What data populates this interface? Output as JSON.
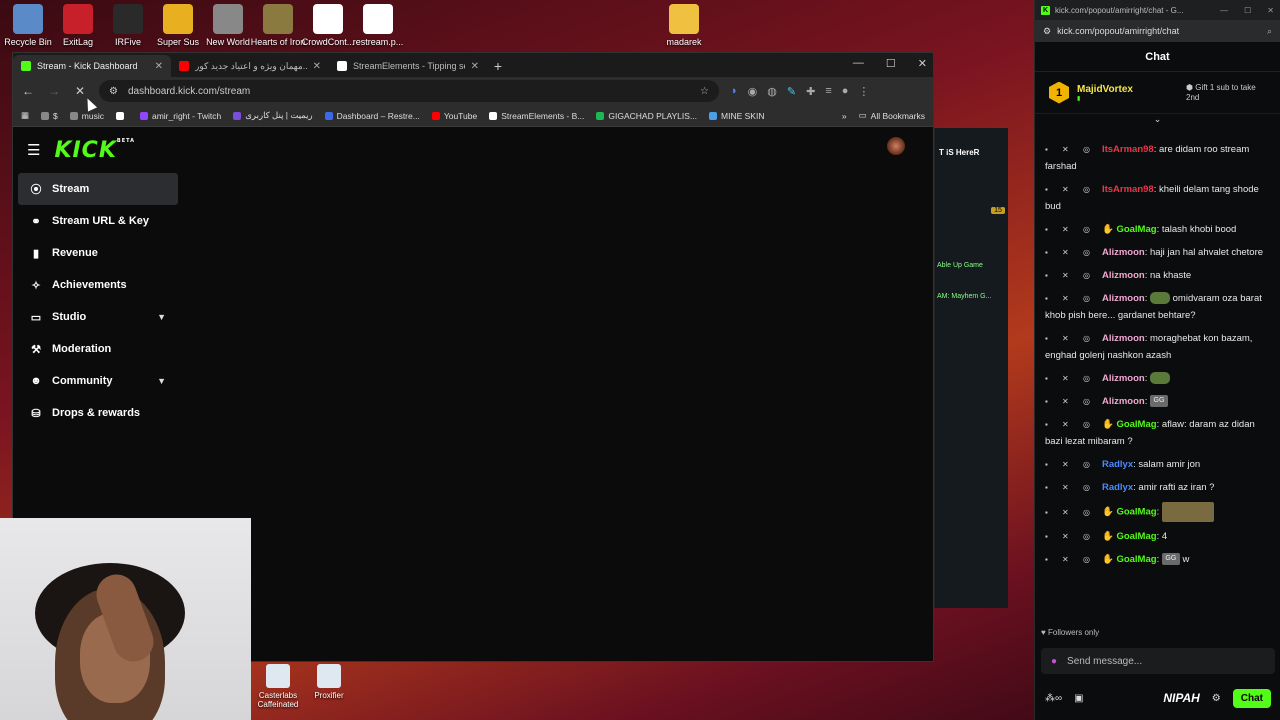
{
  "desktop": {
    "icons": [
      {
        "label": "Recycle Bin",
        "icon": "recycle-bin-icon",
        "color": "#5a8ac8"
      },
      {
        "label": "ExitLag",
        "icon": "exitlag-icon",
        "color": "#c8202a"
      },
      {
        "label": "IRFive",
        "icon": "irfive-icon",
        "color": "#2a2a2a"
      },
      {
        "label": "Super Sus",
        "icon": "supersus-icon",
        "color": "#e8b020"
      },
      {
        "label": "New World",
        "icon": "newworld-icon",
        "color": "#888888"
      },
      {
        "label": "Hearts of Iron",
        "icon": "hoi-icon",
        "color": "#8a7a40"
      },
      {
        "label": "CrowdCont...",
        "icon": "file-icon",
        "color": "#ffffff"
      },
      {
        "label": "restream.p...",
        "icon": "file-icon",
        "color": "#ffffff"
      },
      {
        "label": "madarek",
        "icon": "folder-icon",
        "color": "#f0c040"
      }
    ],
    "taskbar_icons": [
      {
        "label": "Casterlabs Caffeinated"
      },
      {
        "label": "Proxifier"
      }
    ]
  },
  "browser": {
    "tabs": [
      {
        "title": "Stream - Kick Dashboard",
        "active": true,
        "favicon_color": "#53fc18"
      },
      {
        "title": "مهمان ویژه و اعتیاد جدید کور...",
        "active": false,
        "favicon_color": "#ff0000"
      },
      {
        "title": "StreamElements - Tipping setti...",
        "active": false,
        "favicon_color": "#ffffff"
      }
    ],
    "newtab": "+",
    "window_controls": {
      "min": "—",
      "max": "☐",
      "close": "✕"
    },
    "address": "dashboard.kick.com/stream",
    "bookmarks": [
      {
        "label": "$",
        "color": "#888888"
      },
      {
        "label": "music",
        "color": "#888888"
      },
      {
        "label": "",
        "color": "#ffffff"
      },
      {
        "label": "amir_right - Twitch",
        "color": "#9146ff"
      },
      {
        "label": "ریمیت | پنل کاربری",
        "color": "#7a4fd8"
      },
      {
        "label": "Dashboard – Restre...",
        "color": "#3a6ae8"
      },
      {
        "label": "YouTube",
        "color": "#ff0000"
      },
      {
        "label": "StreamElements - B...",
        "color": "#ffffff"
      },
      {
        "label": "GIGACHAD PLAYLIS...",
        "color": "#1db954"
      },
      {
        "label": "MINE SKIN",
        "color": "#4aa0e8"
      }
    ],
    "all_bookmarks": "All Bookmarks"
  },
  "kick": {
    "logo": "KICK",
    "logo_badge": "BETA",
    "sidebar": [
      {
        "label": "Stream",
        "icon": "broadcast-icon",
        "glyph": "⦿",
        "active": true,
        "expandable": false
      },
      {
        "label": "Stream URL & Key",
        "icon": "link-icon",
        "glyph": "⚭",
        "active": false,
        "expandable": false
      },
      {
        "label": "Revenue",
        "icon": "chart-icon",
        "glyph": "▮",
        "active": false,
        "expandable": false
      },
      {
        "label": "Achievements",
        "icon": "trophy-icon",
        "glyph": "✧",
        "active": false,
        "expandable": false
      },
      {
        "label": "Studio",
        "icon": "studio-icon",
        "glyph": "▭",
        "active": false,
        "expandable": true
      },
      {
        "label": "Moderation",
        "icon": "wrench-icon",
        "glyph": "⚒",
        "active": false,
        "expandable": false
      },
      {
        "label": "Community",
        "icon": "people-icon",
        "glyph": "☻",
        "active": false,
        "expandable": true
      },
      {
        "label": "Drops & rewards",
        "icon": "gift-icon",
        "glyph": "⛁",
        "active": false,
        "expandable": false
      }
    ]
  },
  "behind_window": {
    "title": "T iS HereR",
    "count": "15",
    "lines": [
      "Able Up Game",
      "AM: Mayhem G..."
    ]
  },
  "chat": {
    "window_title": "kick.com/popout/amirright/chat - G...",
    "url": "kick.com/popout/amirright/chat",
    "header": "Chat",
    "pinned": {
      "user": "MajidVortex",
      "rank": "1",
      "gift_text": "Gift 1 sub to take 2nd"
    },
    "messages": [
      {
        "user": "ItsArman98",
        "color": "#e8384a",
        "text": "are didam roo stream farshad",
        "badge": false,
        "emote": ""
      },
      {
        "user": "ItsArman98",
        "color": "#e8384a",
        "text": "kheili delam tang shode bud",
        "badge": false,
        "emote": ""
      },
      {
        "user": "GoalMag",
        "color": "#53fc18",
        "text": "talash khobi bood",
        "badge": true,
        "emote": ""
      },
      {
        "user": "Alizmoon",
        "color": "#f0a8d0",
        "text": "haji jan hal ahvalet chetore",
        "badge": false,
        "emote": ""
      },
      {
        "user": "Alizmoon",
        "color": "#f0a8d0",
        "text": "na khaste",
        "badge": false,
        "emote": ""
      },
      {
        "user": "Alizmoon",
        "color": "#f0a8d0",
        "text": "omidvaram oza barat khob pish bere... gardanet behtare?",
        "badge": false,
        "emote": "frog"
      },
      {
        "user": "Alizmoon",
        "color": "#f0a8d0",
        "text": "moraghebat kon bazam, enghad golenj nashkon azash",
        "badge": false,
        "emote": ""
      },
      {
        "user": "Alizmoon",
        "color": "#f0a8d0",
        "text": "",
        "badge": false,
        "emote": "frog"
      },
      {
        "user": "Alizmoon",
        "color": "#f0a8d0",
        "text": "",
        "badge": false,
        "emote": "gg"
      },
      {
        "user": "GoalMag",
        "color": "#53fc18",
        "text": "aflaw: daram az didan bazi lezat mibaram ?",
        "badge": true,
        "emote": ""
      },
      {
        "user": "Radlyx",
        "color": "#4a8aff",
        "text": "salam amir jon",
        "badge": false,
        "emote": ""
      },
      {
        "user": "Radlyx",
        "color": "#4a8aff",
        "text": "amir rafti az iran ?",
        "badge": false,
        "emote": ""
      },
      {
        "user": "GoalMag",
        "color": "#53fc18",
        "text": "",
        "badge": true,
        "emote": "big"
      },
      {
        "user": "GoalMag",
        "color": "#53fc18",
        "text": "4",
        "badge": true,
        "emote": ""
      },
      {
        "user": "GoalMag",
        "color": "#53fc18",
        "text": "w",
        "badge": true,
        "emote": "gg"
      }
    ],
    "followers_only": "Followers only",
    "send_placeholder": "Send message...",
    "footer_brand": "NIPAH",
    "chat_button": "Chat"
  }
}
